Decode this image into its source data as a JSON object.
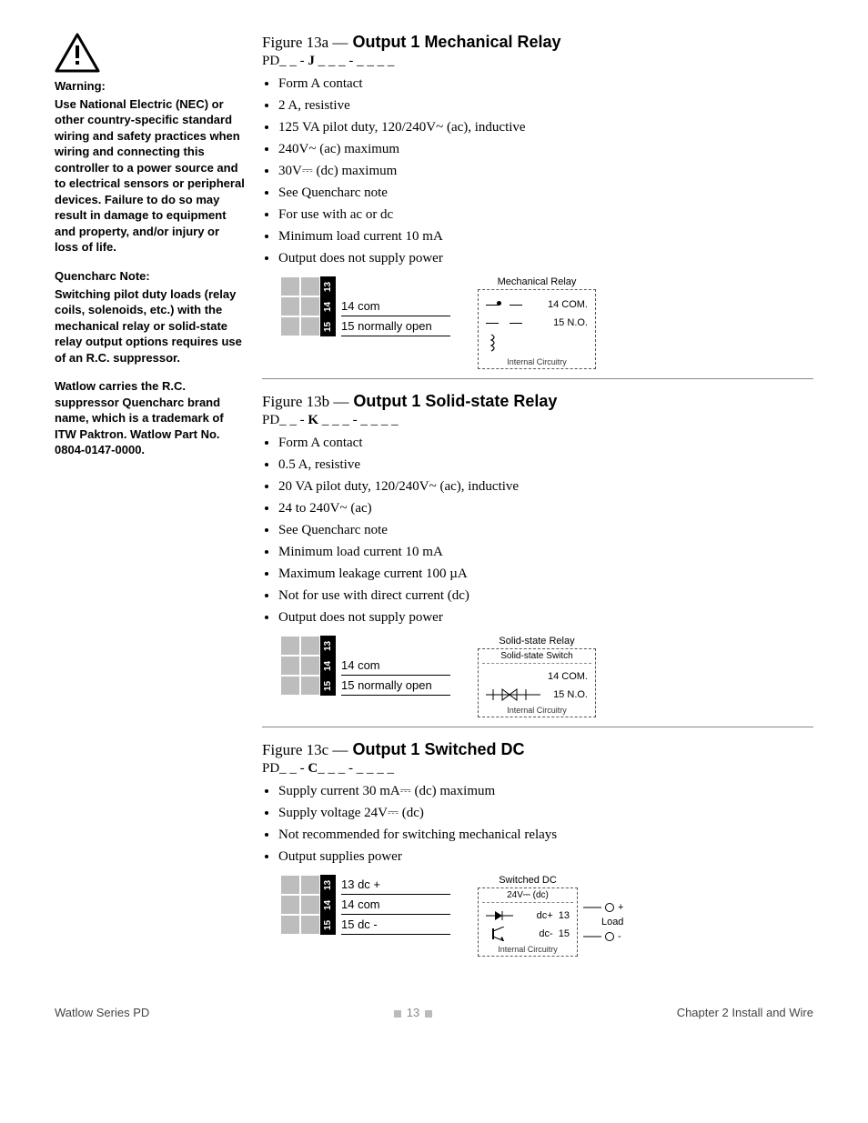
{
  "sidebar": {
    "warning_heading": "Warning:",
    "warning_text": "Use National Electric (NEC) or other country-specific standard wiring and safety practices when wiring and connecting this controller to a power source and to electrical sensors or peripheral devices. Failure to do so may result in damage to equipment and property, and/or injury or loss of life.",
    "quencharc_heading": "Quencharc Note:",
    "quencharc_text": "Switching pilot duty loads (relay coils, solenoids, etc.) with the mechanical relay or solid-state relay output options requires use of an R.C. suppressor.",
    "quencharc_note2": "Watlow carries the R.C. suppressor Quencharc brand name, which is a trademark of ITW Paktron. Watlow Part No. 0804-0147-0000."
  },
  "figures": [
    {
      "id": "13a",
      "prefix": "Figure 13a —",
      "name": "Output 1 Mechanical Relay",
      "partno_prefix": "PD_ _ - ",
      "partno_code": "J",
      "partno_suffix": " _ _ _ - _ _ _ _",
      "specs": [
        "Form A contact",
        "2 A, resistive",
        "125 VA pilot duty, 120/240V~ (ac), inductive",
        "240V~ (ac) maximum",
        "30V⎓ (dc) maximum",
        "See Quencharc note",
        "For use with ac or dc",
        "Minimum load current 10 mA",
        "Output does not supply power"
      ],
      "terminals": [
        {
          "num": "13",
          "label": ""
        },
        {
          "num": "14",
          "label": "14  com"
        },
        {
          "num": "15",
          "label": "15  normally open"
        }
      ],
      "schematic": {
        "title": "Mechanical Relay",
        "pins": [
          {
            "num": "14",
            "name": "COM."
          },
          {
            "num": "15",
            "name": "N.O."
          }
        ],
        "footer": "Internal Circuitry"
      }
    },
    {
      "id": "13b",
      "prefix": "Figure 13b —",
      "name": "Output 1 Solid-state Relay",
      "partno_prefix": "PD_ _ - ",
      "partno_code": "K",
      "partno_suffix": " _ _ _ - _ _ _ _",
      "specs": [
        "Form A contact",
        "0.5 A, resistive",
        "20 VA pilot duty, 120/240V~ (ac), inductive",
        "24 to 240V~ (ac)",
        "See Quencharc note",
        "Minimum load current 10 mA",
        "Maximum leakage current 100 µA",
        "Not for use with direct current (dc)",
        "Output does not supply power"
      ],
      "terminals": [
        {
          "num": "13",
          "label": ""
        },
        {
          "num": "14",
          "label": "14  com"
        },
        {
          "num": "15",
          "label": "15  normally open"
        }
      ],
      "schematic": {
        "title": "Solid-state Relay",
        "subtitle": "Solid-state Switch",
        "pins": [
          {
            "num": "14",
            "name": "COM."
          },
          {
            "num": "15",
            "name": "N.O."
          }
        ],
        "footer": "Internal Circuitry"
      }
    },
    {
      "id": "13c",
      "prefix": "Figure 13c —",
      "name": "Output 1 Switched DC",
      "partno_prefix": "PD_ _ - ",
      "partno_code": "C",
      "partno_suffix": "_ _ _ - _ _ _ _",
      "specs": [
        "Supply current 30 mA⎓ (dc) maximum",
        "Supply voltage 24V⎓ (dc)",
        "Not recommended for switching mechanical relays",
        "Output supplies power"
      ],
      "terminals": [
        {
          "num": "13",
          "label": "13  dc +"
        },
        {
          "num": "14",
          "label": "14  com"
        },
        {
          "num": "15",
          "label": "15  dc -"
        }
      ],
      "schematic": {
        "title": "Switched DC",
        "subtitle": "24V⎓ (dc)",
        "pins": [
          {
            "num": "13",
            "name": "dc+",
            "ext": "+"
          },
          {
            "num": "15",
            "name": "dc-",
            "ext": "-"
          }
        ],
        "load_label": "Load",
        "footer": "Internal Circuitry"
      }
    }
  ],
  "footer": {
    "left": "Watlow Series PD",
    "mid": "13",
    "right": "Chapter 2 Install and Wire"
  }
}
